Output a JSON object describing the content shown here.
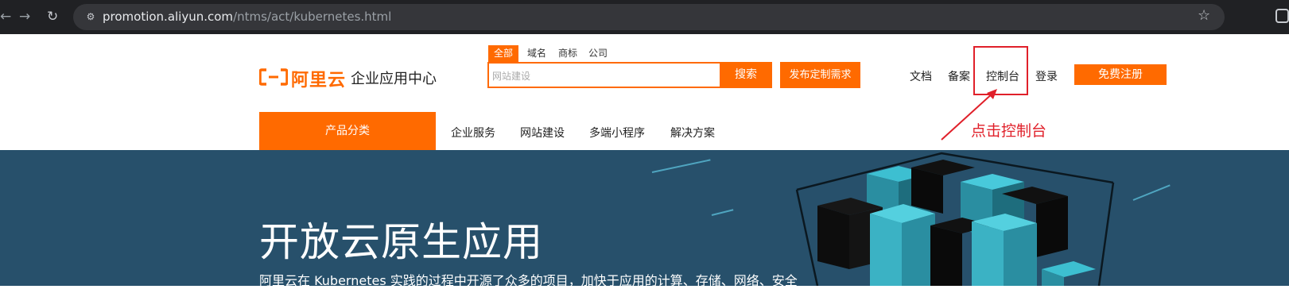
{
  "browser": {
    "url_host": "promotion.aliyun.com",
    "url_path": "/ntms/act/kubernetes.html",
    "nav_icons": [
      "back-arrow-icon",
      "forward-arrow-icon",
      "reload-icon",
      "site-settings-icon",
      "bookmark-star-icon",
      "extension-icon"
    ]
  },
  "header": {
    "logo_text": "阿里云",
    "logo_sub": "企业应用中心",
    "search_tabs": [
      "全部",
      "域名",
      "商标",
      "公司"
    ],
    "search_placeholder": "网站建设",
    "search_button": "搜索",
    "publish_button": "发布定制需求",
    "links": [
      "文档",
      "备案",
      "控制台",
      "登录"
    ],
    "register_button": "免费注册"
  },
  "annotation": {
    "text": "点击控制台",
    "color": "#e0202a"
  },
  "nav": {
    "product_category": "产品分类",
    "items": [
      "企业服务",
      "网站建设",
      "多端小程序",
      "解决方案"
    ]
  },
  "hero": {
    "title": "开放云原生应用",
    "description": "阿里云在 Kubernetes 实践的过程中开源了众多的项目，加快于应用的计算、存储、网络、安全"
  },
  "colors": {
    "brand": "#ff6a00",
    "hero_bg": "#27506b",
    "chrome_bg": "#202124"
  }
}
